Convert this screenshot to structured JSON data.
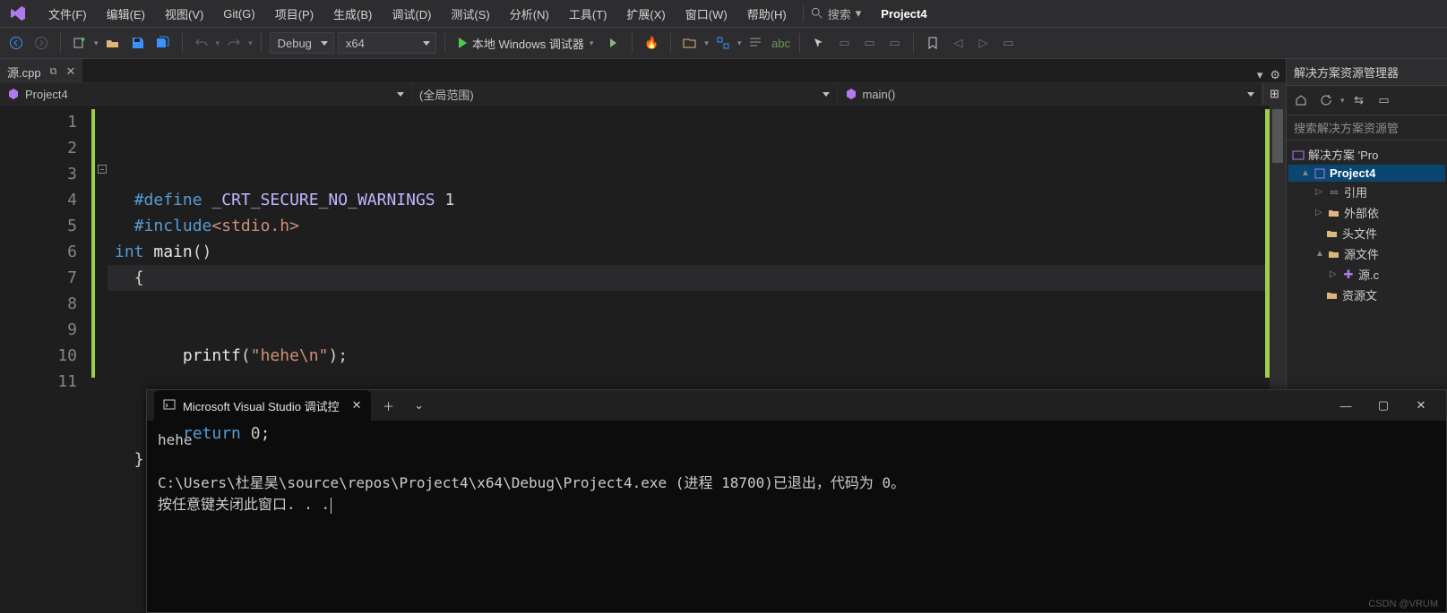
{
  "menu": {
    "items": [
      "文件(F)",
      "编辑(E)",
      "视图(V)",
      "Git(G)",
      "项目(P)",
      "生成(B)",
      "调试(D)",
      "测试(S)",
      "分析(N)",
      "工具(T)",
      "扩展(X)",
      "窗口(W)",
      "帮助(H)"
    ],
    "search_label": "搜索",
    "search_chevron": "▾",
    "project_name": "Project4"
  },
  "toolbar": {
    "config_label": "Debug",
    "platform_label": "x64",
    "start_label": "本地 Windows 调试器"
  },
  "tabs": {
    "file_name": "源.cpp",
    "pin_glyph": "📌",
    "close_glyph": "✕"
  },
  "code_nav": {
    "project_scope": "Project4",
    "scope": "(全局范围)",
    "member": "main()"
  },
  "editor": {
    "line_numbers": [
      "1",
      "2",
      "3",
      "4",
      "5",
      "6",
      "7",
      "8",
      "9",
      "10",
      "11"
    ],
    "l1": {
      "a": "#define",
      "b": "_CRT_SECURE_NO_WARNINGS",
      "c": "1"
    },
    "l2": {
      "a": "#include",
      "b": "<stdio.h>"
    },
    "l3": {
      "a": "int",
      "b": "main",
      "c": "()"
    },
    "l4": "{",
    "l7": {
      "a": "printf",
      "b": "(",
      "c": "\"hehe\\n\"",
      "d": ");"
    },
    "l10": {
      "a": "return",
      "b": "0",
      "c": ";"
    },
    "l11": "}"
  },
  "solution": {
    "title": "解决方案资源管理器",
    "search_placeholder": "搜索解决方案资源管",
    "root": "解决方案 'Pro",
    "project": "Project4",
    "nodes": {
      "refs": "引用",
      "ext": "外部依",
      "hdr": "头文件",
      "src": "源文件",
      "file": "源.c",
      "res": "资源文"
    }
  },
  "console": {
    "tab_title": "Microsoft Visual Studio 调试控",
    "plus": "＋",
    "chevron": "⌄",
    "line1": "hehe",
    "line2": "C:\\Users\\杜星昊\\source\\repos\\Project4\\x64\\Debug\\Project4.exe (进程 18700)已退出，代码为 0。",
    "line3": "按任意键关闭此窗口. . ."
  },
  "watermark": "CSDN @VRUM"
}
